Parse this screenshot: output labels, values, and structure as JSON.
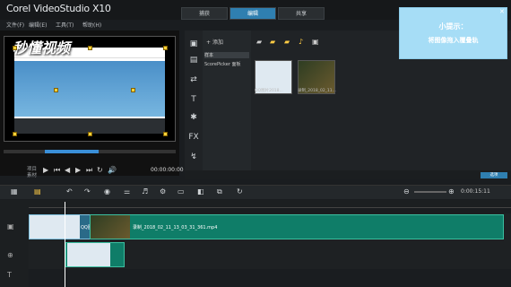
{
  "app": {
    "title": "Corel VideoStudio X10"
  },
  "menu": [
    "文件(F)",
    "编辑(E)",
    "工具(T)",
    "帮助(H)"
  ],
  "tabs": [
    {
      "label": "捕获"
    },
    {
      "label": "编辑"
    },
    {
      "label": "共享"
    }
  ],
  "preview": {
    "watermark": "秒懂视频",
    "mode_project": "项目",
    "mode_clip": "素材",
    "timecode": "00:00:00:00"
  },
  "library": {
    "add_label": "添加",
    "folders": [
      "样本",
      "ScorePicker 面板"
    ],
    "browse_label": "浏览",
    "panel_button": "选项",
    "thumbs": [
      {
        "caption": "QQ图片2018..."
      },
      {
        "caption": "录制_2018_02_11..."
      }
    ]
  },
  "tooltip": {
    "title": "小提示：",
    "body": "将图像拖入覆叠轨"
  },
  "timeline": {
    "zoom_readout": "0:00:15:11",
    "clips": [
      {
        "label": "QQ图..."
      },
      {
        "label": "录制_2018_02_11_13_03_31_361.mp4"
      },
      {
        "label": ""
      }
    ]
  }
}
